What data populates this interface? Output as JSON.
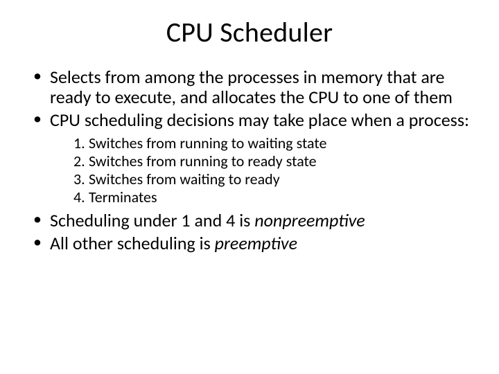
{
  "title": "CPU Scheduler",
  "bullets": {
    "b1": "Selects from among the processes in memory that are ready to execute, and allocates the CPU to one of them",
    "b2": "CPU scheduling decisions may take place when a process:",
    "sub": {
      "s1": "Switches from running to waiting state",
      "s2": "Switches from running to ready state",
      "s3": "Switches from waiting to ready",
      "s4": "Terminates"
    },
    "b3_pre": "Scheduling under 1 and 4 is ",
    "b3_em": "nonpreemptive",
    "b4_pre": "All other scheduling is ",
    "b4_em": "preemptive"
  }
}
